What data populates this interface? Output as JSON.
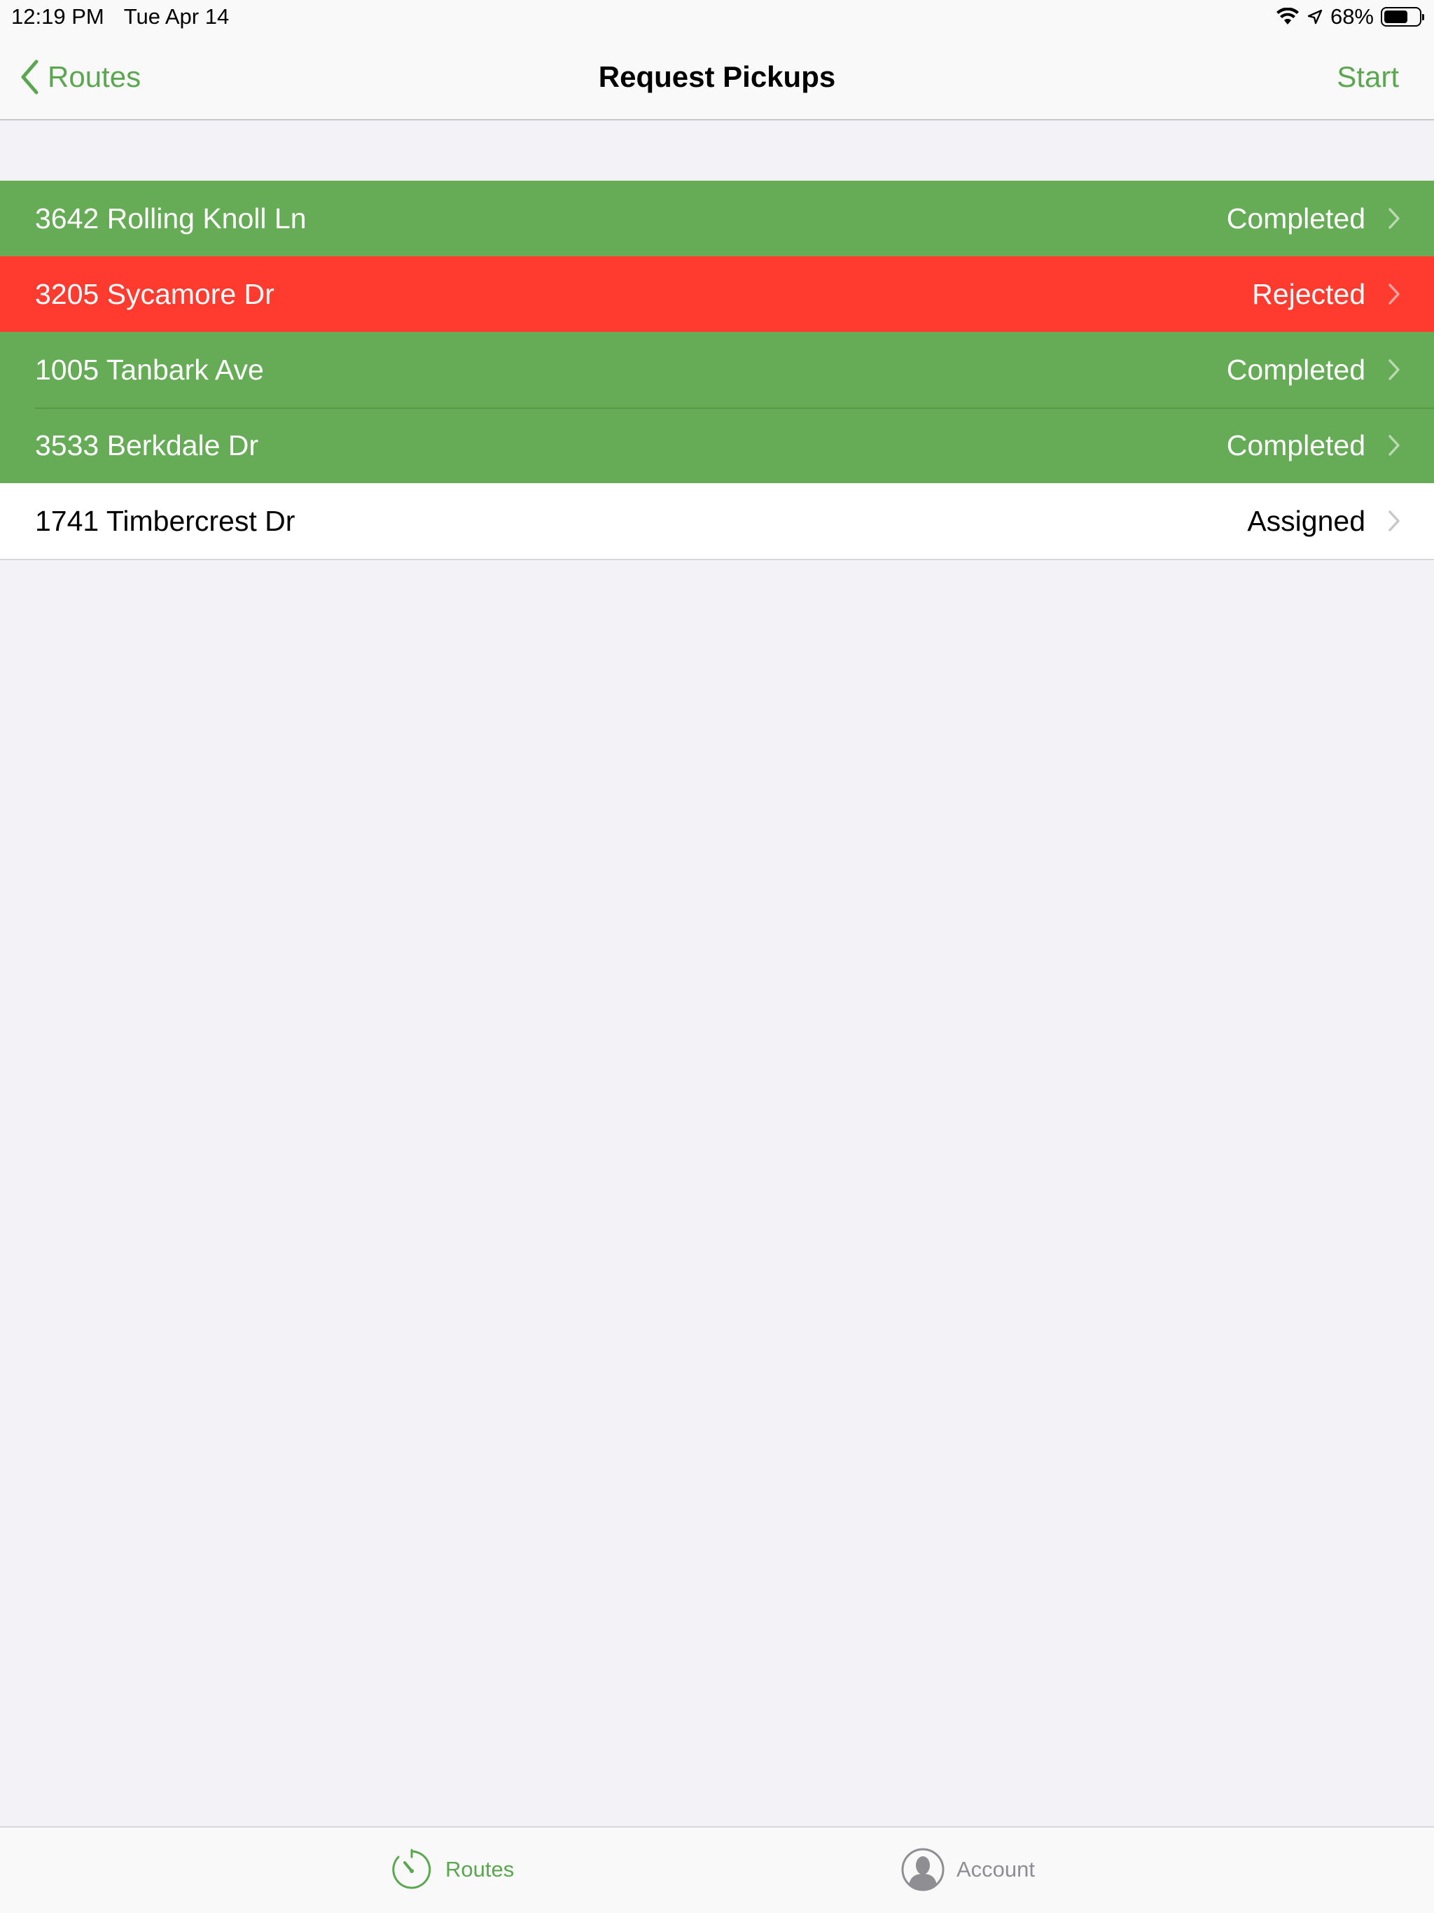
{
  "status_bar": {
    "time": "12:19 PM",
    "date": "Tue Apr 14",
    "battery_percent": "68%",
    "battery_level": 0.68
  },
  "nav": {
    "back_label": "Routes",
    "title": "Request Pickups",
    "action_label": "Start"
  },
  "colors": {
    "accent": "#5aa74f",
    "completed": "#66ac56",
    "rejected": "#ff3b30"
  },
  "pickups": [
    {
      "address": "3642 Rolling Knoll Ln",
      "status": "Completed"
    },
    {
      "address": "3205 Sycamore Dr",
      "status": "Rejected"
    },
    {
      "address": "1005 Tanbark Ave",
      "status": "Completed"
    },
    {
      "address": "3533 Berkdale Dr",
      "status": "Completed"
    },
    {
      "address": "1741 Timbercrest Dr",
      "status": "Assigned"
    }
  ],
  "tabs": [
    {
      "label": "Routes",
      "icon": "timer-icon",
      "selected": true
    },
    {
      "label": "Account",
      "icon": "person-icon",
      "selected": false
    }
  ]
}
